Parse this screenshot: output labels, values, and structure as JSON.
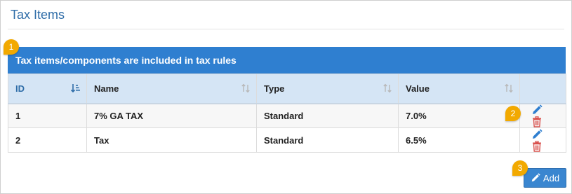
{
  "page": {
    "title": "Tax Items"
  },
  "info_bar": {
    "text": "Tax items/components are included in tax rules"
  },
  "table": {
    "headers": [
      {
        "label": "ID",
        "sorted": true
      },
      {
        "label": "Name",
        "sorted": false
      },
      {
        "label": "Type",
        "sorted": false
      },
      {
        "label": "Value",
        "sorted": false
      },
      {
        "label": "",
        "sorted": false
      }
    ],
    "rows": [
      {
        "id": "1",
        "name": "7% GA TAX",
        "type": "Standard",
        "value": "7.0%"
      },
      {
        "id": "2",
        "name": "Tax",
        "type": "Standard",
        "value": "6.5%"
      }
    ]
  },
  "add_button": {
    "label": "Add",
    "icon": "pencil-icon"
  },
  "markers": [
    "1",
    "2",
    "3"
  ],
  "colors": {
    "title": "#2f6da8",
    "info_bar": "#2f7fd0",
    "header_bg": "#d5e5f5",
    "edit_icon": "#2f7fd0",
    "delete_icon": "#d9534f",
    "add_button": "#3a86d0",
    "marker": "#f2a900"
  }
}
